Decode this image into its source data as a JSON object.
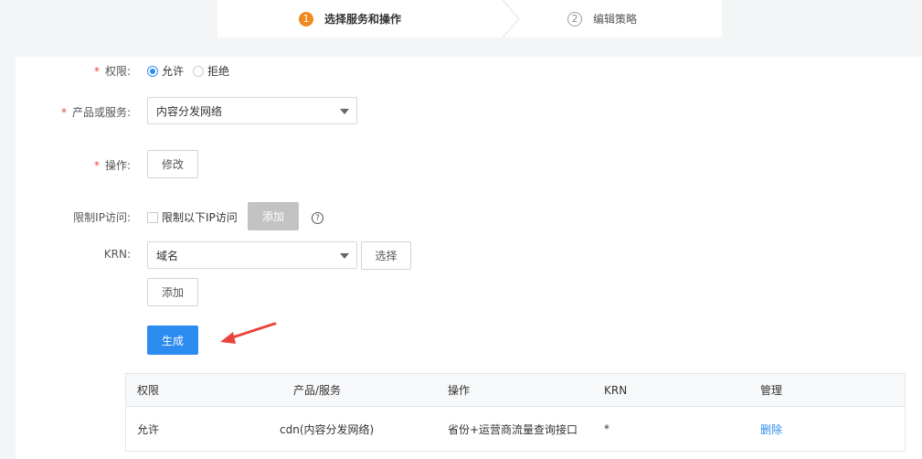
{
  "steps": [
    {
      "num": "1",
      "label": "选择服务和操作"
    },
    {
      "num": "2",
      "label": "编辑策略"
    }
  ],
  "form": {
    "permission": {
      "label": "权限:",
      "options": [
        "允许",
        "拒绝"
      ],
      "selected": "允许"
    },
    "product": {
      "label": "产品或服务:",
      "value": "内容分发网络"
    },
    "operation": {
      "label": "操作:",
      "button": "修改"
    },
    "ip_limit": {
      "label": "限制IP访问:",
      "checkbox_label": "限制以下IP访问",
      "add_button": "添加",
      "help": "?"
    },
    "krn": {
      "label": "KRN:",
      "select_value": "域名",
      "choose_button": "选择",
      "add_button": "添加"
    },
    "generate_button": "生成"
  },
  "table": {
    "headers": [
      "权限",
      "产品/服务",
      "操作",
      "KRN",
      "管理"
    ],
    "rows": [
      {
        "permission": "允许",
        "product": "cdn(内容分发网络)",
        "operation": "省份+运营商流量查询接口",
        "krn": "*",
        "action": "删除"
      }
    ]
  },
  "colors": {
    "primary": "#2d8cf0",
    "step_active": "#f0891e",
    "required": "#e8453c",
    "arrow": "#e8453c"
  }
}
